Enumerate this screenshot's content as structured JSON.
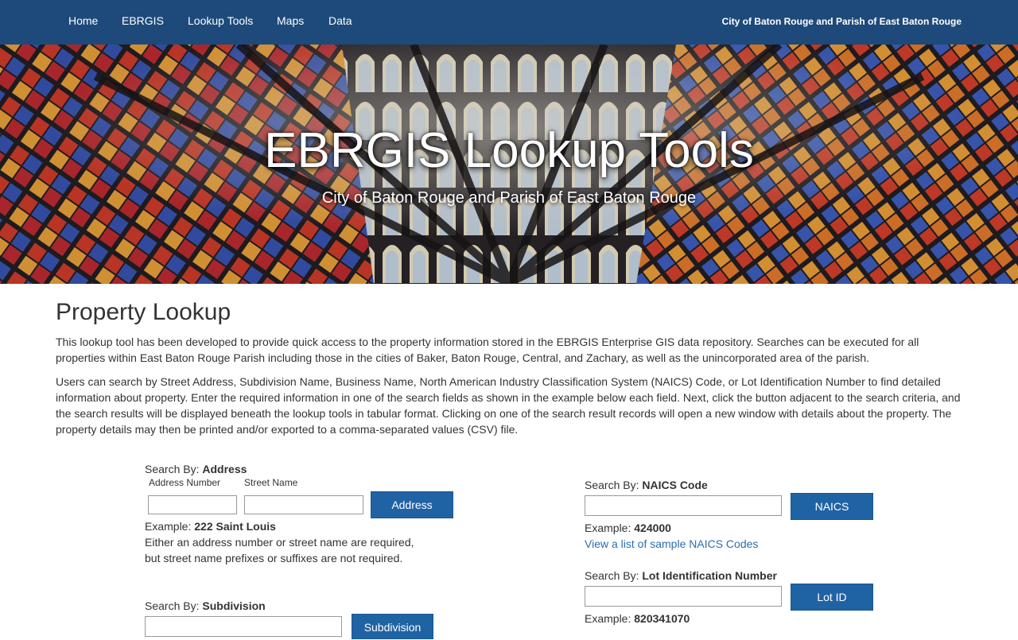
{
  "nav": {
    "items": [
      "Home",
      "EBRGIS",
      "Lookup Tools",
      "Maps",
      "Data"
    ],
    "right_text": "City of Baton Rouge and Parish of East Baton Rouge"
  },
  "hero": {
    "title": "EBRGIS Lookup Tools",
    "subtitle": "City of Baton Rouge and Parish of East Baton Rouge"
  },
  "page": {
    "title": "Property Lookup",
    "para1": "This lookup tool has been developed to provide quick access to the property information stored in the EBRGIS Enterprise GIS data repository. Searches can be executed for all properties within East Baton Rouge Parish including those in the cities of Baker, Baton Rouge, Central, and Zachary, as well as the unincorporated area of the parish.",
    "para2": "Users can search by Street Address, Subdivision Name, Business Name, North American Industry Classification System (NAICS) Code, or Lot Identification Number to find detailed information about property. Enter the required information in one of the search fields as shown in the example below each field. Next, click the button adjacent to the search criteria, and the search results will be displayed beneath the lookup tools in tabular format. Clicking on one of the search result records will open a new window with details about the property. The property details may then be printed and/or exported to a comma-separated values (CSV) file."
  },
  "address": {
    "prefix": "Search By:",
    "name": "Address",
    "number_label": "Address Number",
    "street_label": "Street Name",
    "number_value": "",
    "street_value": "",
    "button": "Address",
    "example_prefix": "Example:",
    "example": "222 Saint Louis",
    "note1": "Either an address number or street name are required,",
    "note2": "but street name prefixes or suffixes are not required."
  },
  "subdivision": {
    "prefix": "Search By:",
    "name": "Subdivision",
    "value": "",
    "button": "Subdivision"
  },
  "naics": {
    "prefix": "Search By:",
    "name": "NAICS Code",
    "value": "",
    "button": "NAICS",
    "example_prefix": "Example:",
    "example": "424000",
    "link": "View a list of sample NAICS Codes"
  },
  "lot": {
    "prefix": "Search By:",
    "name": "Lot Identification Number",
    "value": "",
    "button": "Lot ID",
    "example_prefix": "Example:",
    "example": "820341070"
  }
}
